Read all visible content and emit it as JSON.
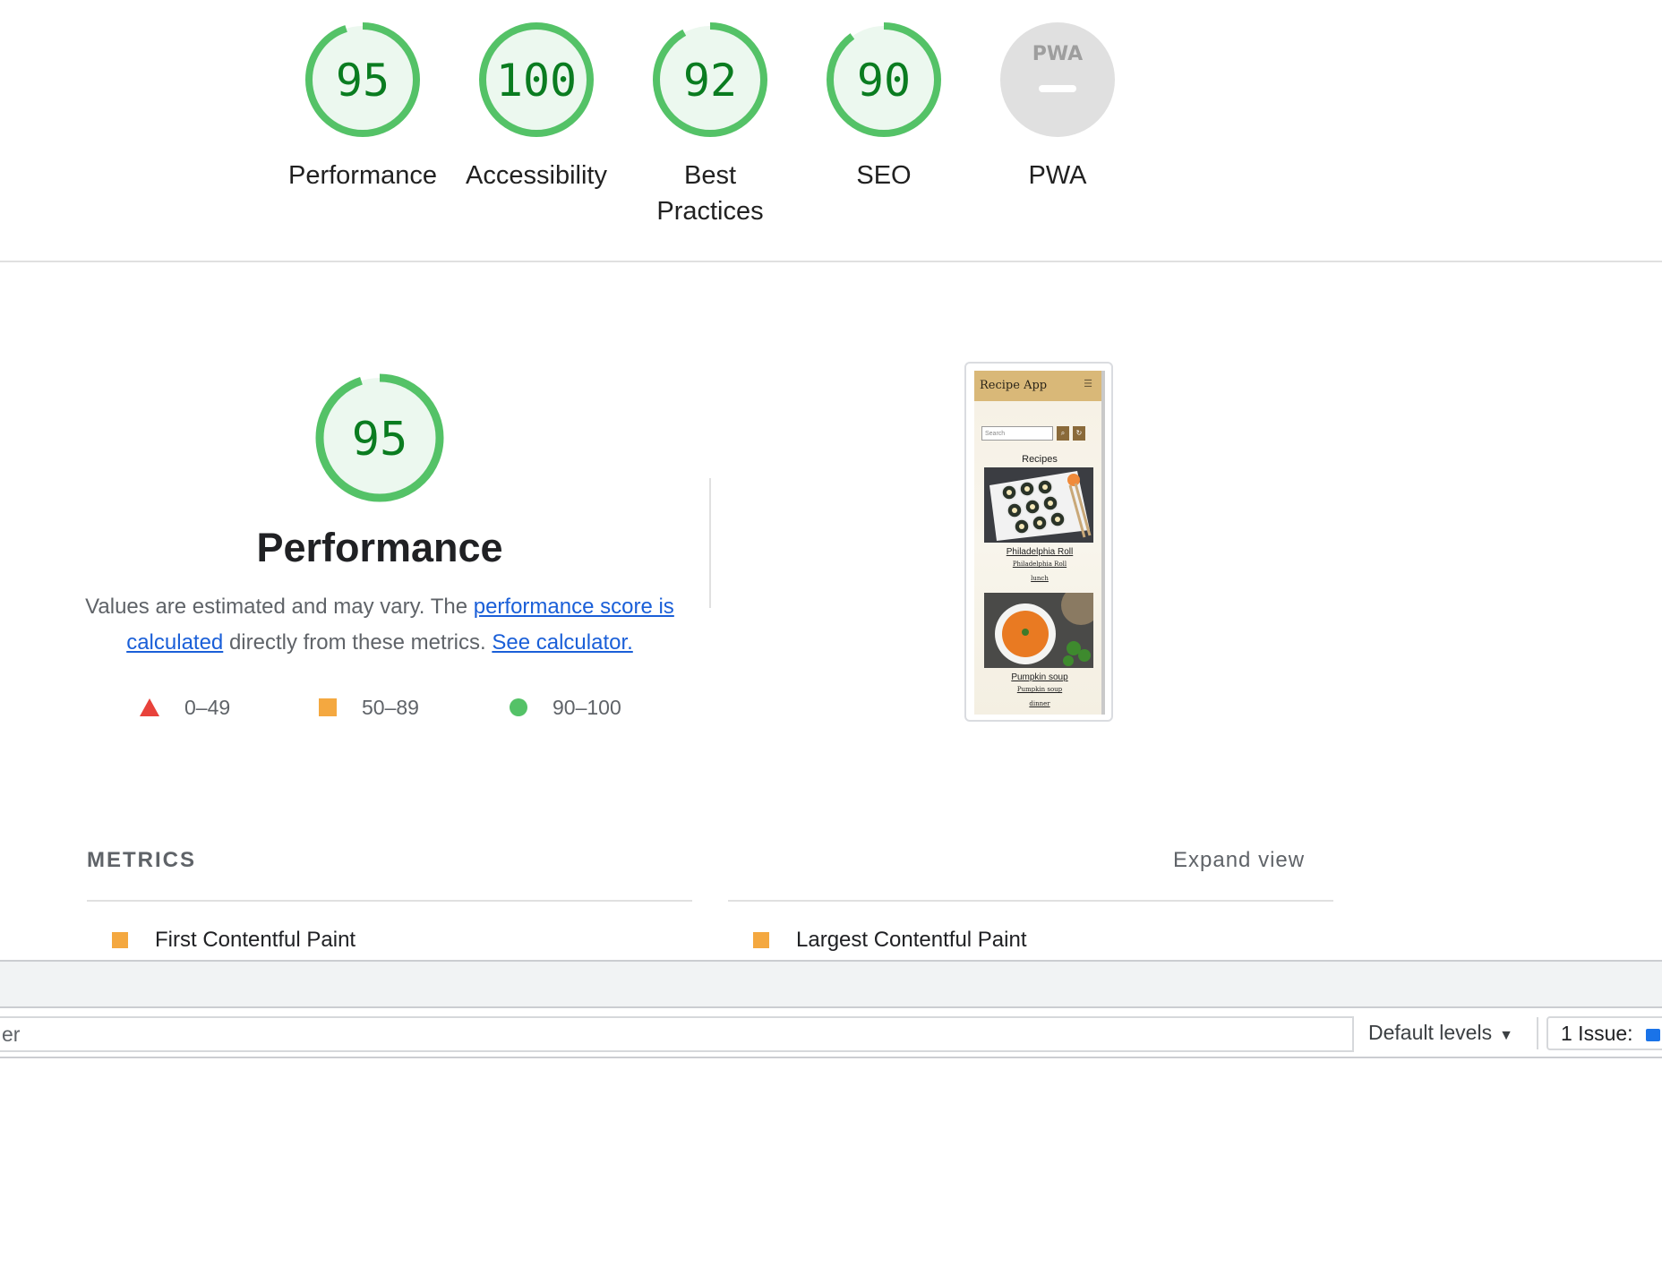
{
  "categories": [
    {
      "score": "95",
      "label": "Performance",
      "fraction": 0.95,
      "color": "#54c267"
    },
    {
      "score": "100",
      "label": "Accessibility",
      "fraction": 1.0,
      "color": "#54c267"
    },
    {
      "score": "92",
      "label": "Best Practices",
      "fraction": 0.92,
      "color": "#54c267"
    },
    {
      "score": "90",
      "label": "SEO",
      "fraction": 0.9,
      "color": "#54c267"
    },
    {
      "label": "PWA",
      "badge_text": "PWA"
    }
  ],
  "performance": {
    "score": "95",
    "fraction": 0.95,
    "title": "Performance",
    "desc_prefix": "Values are estimated and may vary. The ",
    "link_score": "performance score is calculated",
    "desc_mid": " directly from these metrics. ",
    "link_calc": "See calculator.",
    "legend": [
      {
        "range": "0–49",
        "shape": "triangle",
        "color": "#e8423b"
      },
      {
        "range": "50–89",
        "shape": "square",
        "color": "#f4a840"
      },
      {
        "range": "90–100",
        "shape": "circle",
        "color": "#54c267"
      }
    ]
  },
  "screenshot": {
    "app_title": "Recipe App",
    "search_placeholder": "Search",
    "heading": "Recipes",
    "cards": [
      {
        "name": "Philadelphia Roll",
        "subtitle": "Philadelphia Roll",
        "meal": "lunch"
      },
      {
        "name": "Pumpkin soup",
        "subtitle": "Pumpkin soup",
        "meal": "dinner"
      }
    ]
  },
  "metrics": {
    "title": "METRICS",
    "expand": "Expand view",
    "items": [
      {
        "label": "First Contentful Paint",
        "status": "average"
      },
      {
        "label": "Largest Contentful Paint",
        "status": "average"
      }
    ]
  },
  "devtools": {
    "filter_text": "er",
    "levels": "Default levels",
    "issues": "1 Issue:"
  }
}
